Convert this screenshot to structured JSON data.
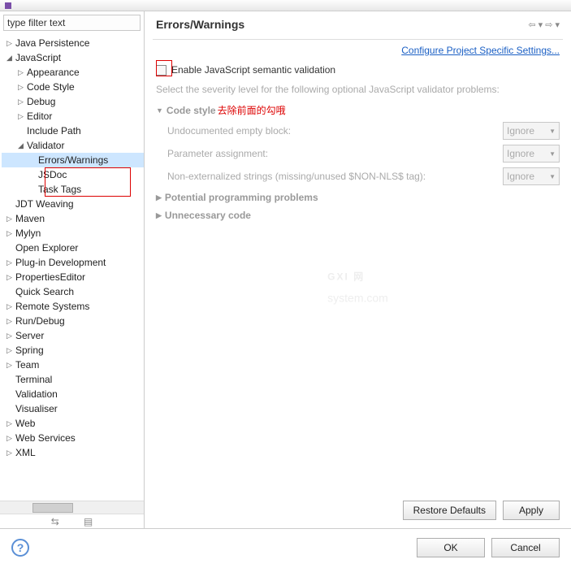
{
  "filter_placeholder": "type filter text",
  "tree": [
    {
      "label": "Java Persistence",
      "indent": 1,
      "tw": "▷"
    },
    {
      "label": "JavaScript",
      "indent": 1,
      "tw": "◢"
    },
    {
      "label": "Appearance",
      "indent": 2,
      "tw": "▷"
    },
    {
      "label": "Code Style",
      "indent": 2,
      "tw": "▷"
    },
    {
      "label": "Debug",
      "indent": 2,
      "tw": "▷"
    },
    {
      "label": "Editor",
      "indent": 2,
      "tw": "▷"
    },
    {
      "label": "Include Path",
      "indent": 2,
      "tw": ""
    },
    {
      "label": "Validator",
      "indent": 2,
      "tw": "◢"
    },
    {
      "label": "Errors/Warnings",
      "indent": 3,
      "tw": "",
      "selected": true
    },
    {
      "label": "JSDoc",
      "indent": 3,
      "tw": ""
    },
    {
      "label": "Task Tags",
      "indent": 3,
      "tw": ""
    },
    {
      "label": "JDT Weaving",
      "indent": 1,
      "tw": ""
    },
    {
      "label": "Maven",
      "indent": 1,
      "tw": "▷"
    },
    {
      "label": "Mylyn",
      "indent": 1,
      "tw": "▷"
    },
    {
      "label": "Open Explorer",
      "indent": 1,
      "tw": ""
    },
    {
      "label": "Plug-in Development",
      "indent": 1,
      "tw": "▷"
    },
    {
      "label": "PropertiesEditor",
      "indent": 1,
      "tw": "▷"
    },
    {
      "label": "Quick Search",
      "indent": 1,
      "tw": ""
    },
    {
      "label": "Remote Systems",
      "indent": 1,
      "tw": "▷"
    },
    {
      "label": "Run/Debug",
      "indent": 1,
      "tw": "▷"
    },
    {
      "label": "Server",
      "indent": 1,
      "tw": "▷"
    },
    {
      "label": "Spring",
      "indent": 1,
      "tw": "▷"
    },
    {
      "label": "Team",
      "indent": 1,
      "tw": "▷"
    },
    {
      "label": "Terminal",
      "indent": 1,
      "tw": ""
    },
    {
      "label": "Validation",
      "indent": 1,
      "tw": ""
    },
    {
      "label": "Visualiser",
      "indent": 1,
      "tw": ""
    },
    {
      "label": "Web",
      "indent": 1,
      "tw": "▷"
    },
    {
      "label": "Web Services",
      "indent": 1,
      "tw": "▷"
    },
    {
      "label": "XML",
      "indent": 1,
      "tw": "▷"
    }
  ],
  "page_title": "Errors/Warnings",
  "nav_arrows": "⇦ ▾  ⇨ ▾",
  "config_link": "Configure Project Specific Settings...",
  "enable_label": "Enable JavaScript semantic validation",
  "desc_text": "Select the severity level for the following optional JavaScript validator problems:",
  "sections": {
    "code_style": {
      "label": "Code style",
      "annot": "去除前面的勾哦"
    },
    "potential": {
      "label": "Potential programming problems"
    },
    "unnecessary": {
      "label": "Unnecessary code"
    }
  },
  "options": [
    {
      "label": "Undocumented empty block:",
      "value": "Ignore"
    },
    {
      "label": "Parameter assignment:",
      "value": "Ignore"
    },
    {
      "label": "Non-externalized strings (missing/unused $NON-NLS$ tag):",
      "value": "Ignore"
    }
  ],
  "buttons": {
    "restore": "Restore Defaults",
    "apply": "Apply",
    "ok": "OK",
    "cancel": "Cancel"
  },
  "watermark": {
    "big": "GXI 网",
    "small": "system.com"
  }
}
